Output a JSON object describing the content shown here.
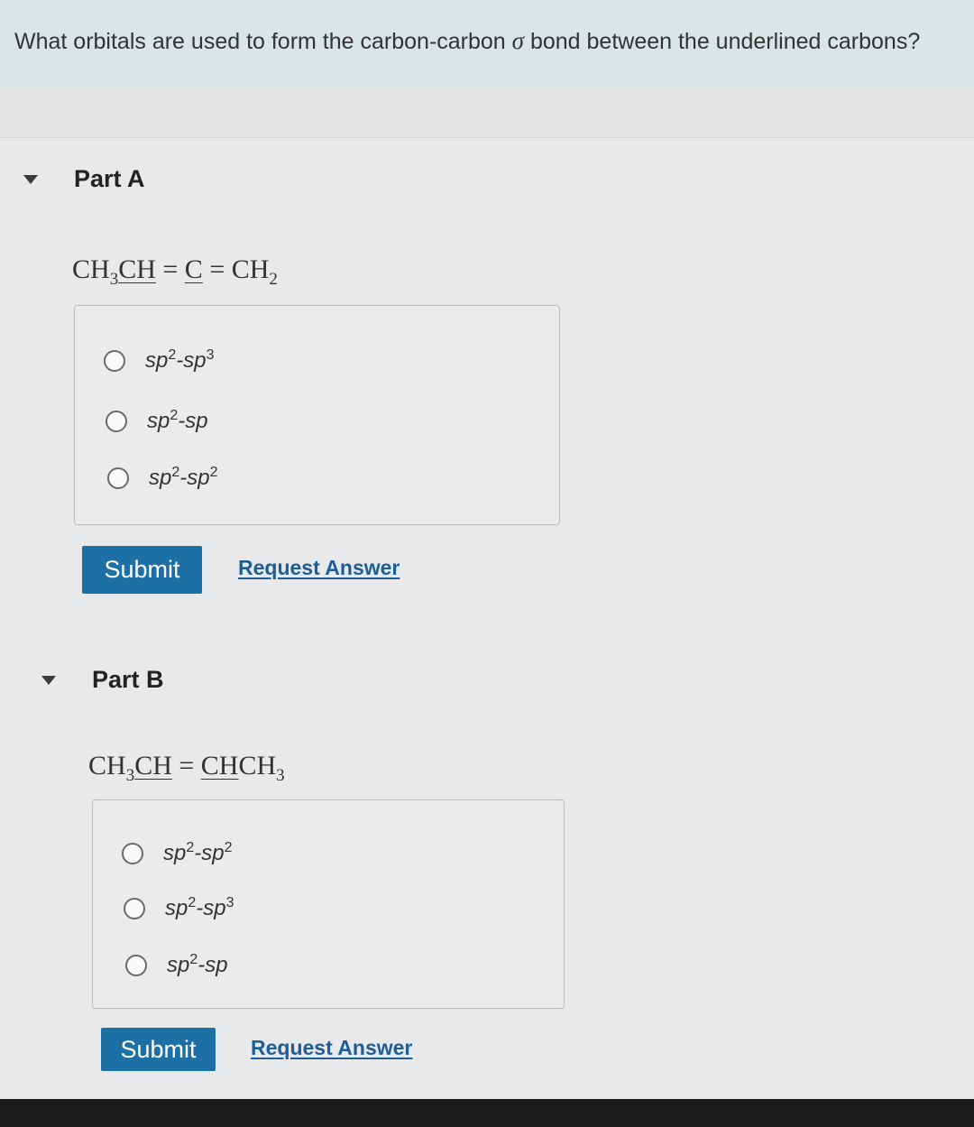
{
  "question": {
    "text_before": "What orbitals are used to form the carbon-carbon",
    "sigma": "σ",
    "text_after": "bond between the underlined carbons?"
  },
  "part_a": {
    "title": "Part A",
    "formula": {
      "p1": "CH",
      "s1": "3",
      "p2_underlined": "CH",
      "p3": " = ",
      "p4_underlined": "C",
      "p5": " = CH",
      "s2": "2"
    },
    "options": [
      {
        "base": "sp",
        "sup1": "2",
        "mid": "-sp",
        "sup2": "3"
      },
      {
        "base": "sp",
        "sup1": "2",
        "mid": "-sp",
        "sup2": ""
      },
      {
        "base": "sp",
        "sup1": "2",
        "mid": "-sp",
        "sup2": "2"
      }
    ],
    "submit_label": "Submit",
    "request_label": "Request Answer"
  },
  "part_b": {
    "title": "Part B",
    "formula": {
      "p1": "CH",
      "s1": "3",
      "p2_underlined": "CH",
      "p3": " = ",
      "p4_underlined": "CH",
      "p5": "CH",
      "s2": "3"
    },
    "options": [
      {
        "base": "sp",
        "sup1": "2",
        "mid": "-sp",
        "sup2": "2"
      },
      {
        "base": "sp",
        "sup1": "2",
        "mid": "-sp",
        "sup2": "3"
      },
      {
        "base": "sp",
        "sup1": "2",
        "mid": "-sp",
        "sup2": ""
      }
    ],
    "submit_label": "Submit",
    "request_label": "Request Answer"
  }
}
